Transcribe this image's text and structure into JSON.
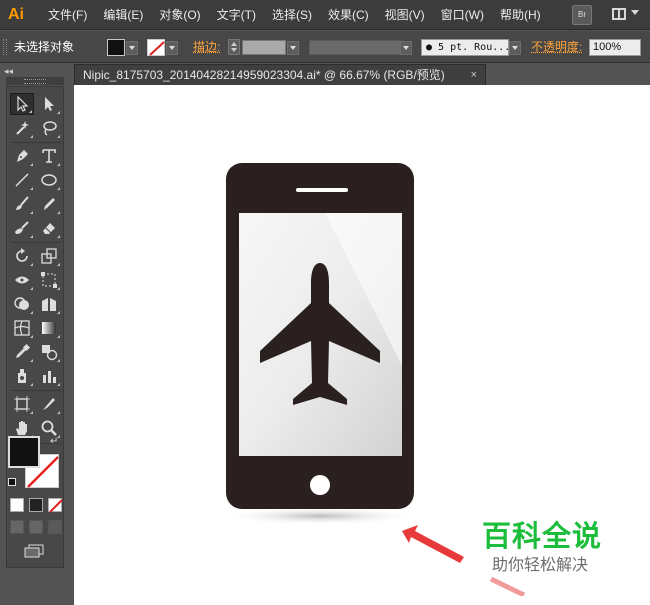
{
  "app": {
    "logo": "Ai"
  },
  "menu": {
    "items": [
      "文件(F)",
      "编辑(E)",
      "对象(O)",
      "文字(T)",
      "选择(S)",
      "效果(C)",
      "视图(V)",
      "窗口(W)",
      "帮助(H)"
    ],
    "bridge_label": "Br"
  },
  "control_bar": {
    "selection_status": "未选择对象",
    "stroke_label": "描边:",
    "brush_value": "● 5 pt. Rou...",
    "opacity_label": "不透明度:",
    "opacity_value": "100%"
  },
  "document": {
    "tab_title": "Nipic_8175703_20140428214959023304.ai* @ 66.67% (RGB/预览)",
    "close_glyph": "×"
  },
  "toolbox": {
    "collapse_glyph": "◂◂",
    "swap_glyph": "↵",
    "tools": [
      "selection-tool",
      "direct-selection-tool",
      "magic-wand-tool",
      "lasso-tool",
      "pen-tool",
      "type-tool",
      "line-tool",
      "ellipse-tool",
      "paintbrush-tool",
      "pencil-tool",
      "blob-brush-tool",
      "eraser-tool",
      "rotate-tool",
      "scale-tool",
      "width-tool",
      "free-transform-tool",
      "shape-builder-tool",
      "perspective-grid-tool",
      "mesh-tool",
      "gradient-tool",
      "eyedropper-tool",
      "blend-tool",
      "symbol-sprayer-tool",
      "column-graph-tool",
      "artboard-tool",
      "slice-tool",
      "hand-tool",
      "zoom-tool"
    ]
  },
  "colors": {
    "accent_orange": "#ffa43a",
    "fill": "#111111",
    "stroke": "none",
    "phone_body": "#2a2020",
    "watermark_green": "#1cbd3a",
    "arrow_red": "#e83a3a"
  },
  "watermark": {
    "title": "百科全说",
    "subtitle": "助你轻松解决"
  }
}
